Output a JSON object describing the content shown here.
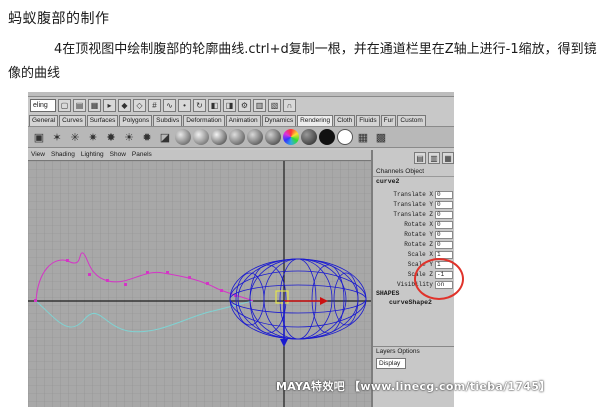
{
  "article": {
    "heading": "蚂蚁腹部的制作",
    "paragraph": "4在顶视图中绘制腹部的轮廓曲线.ctrl+d复制一根，并在通道栏里在Z轴上进行-1缩放，得到镜像的曲线"
  },
  "maya": {
    "status_line": {
      "mode_value": "eling"
    },
    "shelf_tabs": [
      "General",
      "Curves",
      "Surfaces",
      "Polygons",
      "Subdivs",
      "Deformation",
      "Animation",
      "Dynamics",
      "Rendering",
      "Cloth",
      "Fluids",
      "Fur",
      "Custom"
    ],
    "active_shelf_tab": "Rendering",
    "viewport_menu": [
      "View",
      "Shading",
      "Lighting",
      "Show",
      "Panels"
    ],
    "channel_box": {
      "menu": [
        "Channels",
        "Object"
      ],
      "node_name": "curve2",
      "attributes": [
        {
          "label": "Translate X",
          "value": "0"
        },
        {
          "label": "Translate Y",
          "value": "0"
        },
        {
          "label": "Translate Z",
          "value": "0"
        },
        {
          "label": "Rotate X",
          "value": "0"
        },
        {
          "label": "Rotate Y",
          "value": "0"
        },
        {
          "label": "Rotate Z",
          "value": "0"
        },
        {
          "label": "Scale X",
          "value": "1"
        },
        {
          "label": "Scale Y",
          "value": "1"
        },
        {
          "label": "Scale Z",
          "value": "-1"
        },
        {
          "label": "Visibility",
          "value": "on"
        }
      ],
      "shapes_heading": "SHAPES",
      "shape_name": "curveShape2"
    },
    "layers": {
      "menu": [
        "Layers",
        "Options"
      ],
      "display_value": "Display"
    },
    "colors": {
      "highlight_circle": "#e0332b",
      "curve_pink": "#d436c6",
      "curve_cyan": "#7fd3d3",
      "wire_blue": "#1a1ad0"
    }
  },
  "watermark": "MAYA特效吧 【www.linecg.com/tieba/1745】"
}
